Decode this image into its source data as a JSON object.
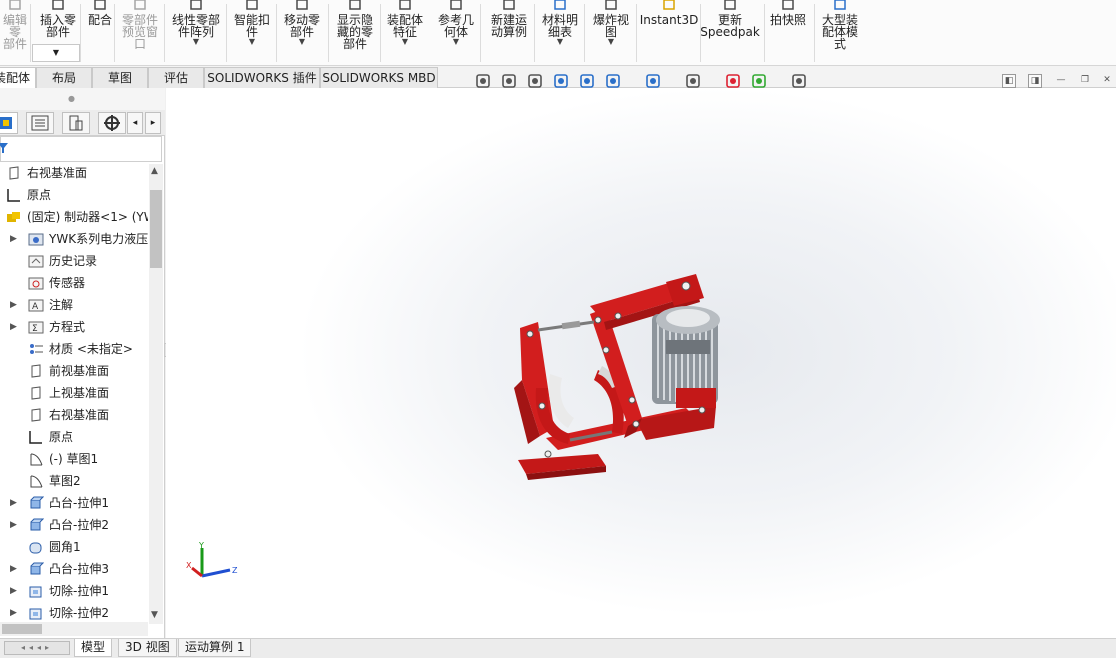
{
  "ribbon": {
    "buttons": [
      {
        "id": "edit-component",
        "label": "编辑零\n部件",
        "disabled": true
      },
      {
        "id": "insert-component",
        "label": "插入零\n部件",
        "disabled": false
      },
      {
        "id": "mate",
        "label": "配合",
        "disabled": false
      },
      {
        "id": "component-preview",
        "label": "零部件\n预览窗\n口",
        "disabled": true
      },
      {
        "id": "linear-pattern",
        "label": "线性零部\n件阵列",
        "disabled": false
      },
      {
        "id": "smart-fasteners",
        "label": "智能扣\n件",
        "disabled": false
      },
      {
        "id": "move-component",
        "label": "移动零\n部件",
        "disabled": false
      },
      {
        "id": "show-hidden",
        "label": "显示隐\n藏的零\n部件",
        "disabled": false
      },
      {
        "id": "assembly-features",
        "label": "装配体\n特征",
        "disabled": false
      },
      {
        "id": "reference-geometry",
        "label": "参考几\n何体",
        "disabled": false
      },
      {
        "id": "new-motion-study",
        "label": "新建运\n动算例",
        "disabled": false
      },
      {
        "id": "bom",
        "label": "材料明\n细表",
        "disabled": false
      },
      {
        "id": "exploded-view",
        "label": "爆炸视\n图",
        "disabled": false
      },
      {
        "id": "instant3d",
        "label": "Instant3D",
        "disabled": false
      },
      {
        "id": "update-speedpak",
        "label": "更新\nSpeedpak",
        "disabled": false
      },
      {
        "id": "snapshot",
        "label": "拍快照",
        "disabled": false
      },
      {
        "id": "large-assembly",
        "label": "大型装\n配体模\n式",
        "disabled": false
      }
    ]
  },
  "tabs": [
    "装配体",
    "布局",
    "草图",
    "评估",
    "SOLIDWORKS 插件",
    "SOLIDWORKS MBD"
  ],
  "tree": [
    {
      "label": "右视基准面",
      "icon": "plane",
      "expand": false,
      "indent": 0
    },
    {
      "label": "原点",
      "icon": "origin",
      "expand": false,
      "indent": 0
    },
    {
      "label": "(固定) 制动器<1> (YW",
      "icon": "assembly",
      "expand": false,
      "indent": 0
    },
    {
      "label": "YWK系列电力液压",
      "icon": "sensor-folder",
      "expand": true,
      "indent": 1
    },
    {
      "label": "历史记录",
      "icon": "history",
      "expand": false,
      "indent": 1
    },
    {
      "label": "传感器",
      "icon": "sensor",
      "expand": false,
      "indent": 1
    },
    {
      "label": "注解",
      "icon": "annotation",
      "expand": true,
      "indent": 1
    },
    {
      "label": "方程式",
      "icon": "equation",
      "expand": true,
      "indent": 1
    },
    {
      "label": "材质 <未指定>",
      "icon": "material",
      "expand": false,
      "indent": 1
    },
    {
      "label": "前视基准面",
      "icon": "plane",
      "expand": false,
      "indent": 1
    },
    {
      "label": "上视基准面",
      "icon": "plane",
      "expand": false,
      "indent": 1
    },
    {
      "label": "右视基准面",
      "icon": "plane",
      "expand": false,
      "indent": 1
    },
    {
      "label": "原点",
      "icon": "origin",
      "expand": false,
      "indent": 1
    },
    {
      "label": "(-) 草图1",
      "icon": "sketch",
      "expand": false,
      "indent": 1
    },
    {
      "label": "草图2",
      "icon": "sketch",
      "expand": false,
      "indent": 1
    },
    {
      "label": "凸台-拉伸1",
      "icon": "extrude",
      "expand": true,
      "indent": 1
    },
    {
      "label": "凸台-拉伸2",
      "icon": "extrude",
      "expand": true,
      "indent": 1
    },
    {
      "label": "圆角1",
      "icon": "fillet",
      "expand": false,
      "indent": 1
    },
    {
      "label": "凸台-拉伸3",
      "icon": "extrude",
      "expand": true,
      "indent": 1
    },
    {
      "label": "切除-拉伸1",
      "icon": "cut",
      "expand": true,
      "indent": 1
    },
    {
      "label": "切除-拉伸2",
      "icon": "cut",
      "expand": true,
      "indent": 1
    }
  ],
  "bottom_tabs": [
    "模型",
    "3D 视图",
    "运动算例 1"
  ],
  "triad": {
    "x": "X",
    "y": "Y",
    "z": "Z"
  },
  "colors": {
    "part_red": "#d21e1e",
    "motor_gray": "#9aa0a6",
    "accent_blue": "#1f6fd1"
  }
}
